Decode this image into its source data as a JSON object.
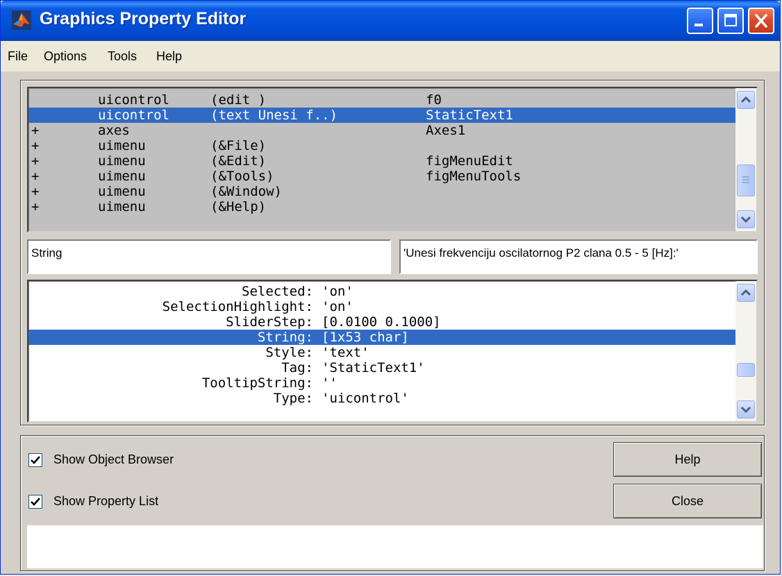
{
  "window": {
    "title": "Graphics Property Editor",
    "colors": {
      "titlebar": "#0350d8",
      "selection": "#316ac5",
      "face": "#d4d0c8"
    }
  },
  "menu": [
    {
      "label": "File"
    },
    {
      "label": "Options"
    },
    {
      "label": "Tools"
    },
    {
      "label": "Help"
    }
  ],
  "object_browser": {
    "rows": [
      {
        "expander": "",
        "type": "uicontrol",
        "args": "(edit )",
        "tag": "f0",
        "selected": false
      },
      {
        "expander": "",
        "type": "uicontrol",
        "args": "(text Unesi f..)",
        "tag": "StaticText1",
        "selected": true
      },
      {
        "expander": "+",
        "type": "axes",
        "args": "",
        "tag": "Axes1",
        "selected": false
      },
      {
        "expander": "+",
        "type": "uimenu",
        "args": "(&File)",
        "tag": "",
        "selected": false
      },
      {
        "expander": "+",
        "type": "uimenu",
        "args": "(&Edit)",
        "tag": "figMenuEdit",
        "selected": false
      },
      {
        "expander": "+",
        "type": "uimenu",
        "args": "(&Tools)",
        "tag": "figMenuTools",
        "selected": false
      },
      {
        "expander": "+",
        "type": "uimenu",
        "args": "(&Window)",
        "tag": "",
        "selected": false
      },
      {
        "expander": "+",
        "type": "uimenu",
        "args": "(&Help)",
        "tag": "",
        "selected": false
      }
    ]
  },
  "property_name": "String",
  "property_value": "'Unesi frekvenciju oscilatornog P2 clana 0.5 - 5 [Hz]:'",
  "property_list": {
    "rows": [
      {
        "name": "Selected:",
        "value": "'on'",
        "selected": false
      },
      {
        "name": "SelectionHighlight:",
        "value": "'on'",
        "selected": false
      },
      {
        "name": "SliderStep:",
        "value": "[0.0100 0.1000]",
        "selected": false
      },
      {
        "name": "String:",
        "value": "[1x53 char]",
        "selected": true
      },
      {
        "name": "Style:",
        "value": "'text'",
        "selected": false
      },
      {
        "name": "Tag:",
        "value": "'StaticText1'",
        "selected": false
      },
      {
        "name": "TooltipString:",
        "value": "''",
        "selected": false
      },
      {
        "name": "Type:",
        "value": "'uicontrol'",
        "selected": false
      }
    ]
  },
  "options": {
    "show_object_browser": {
      "label": "Show Object Browser",
      "checked": true
    },
    "show_property_list": {
      "label": "Show Property List",
      "checked": true
    }
  },
  "buttons": {
    "help": "Help",
    "close": "Close"
  },
  "status": ""
}
